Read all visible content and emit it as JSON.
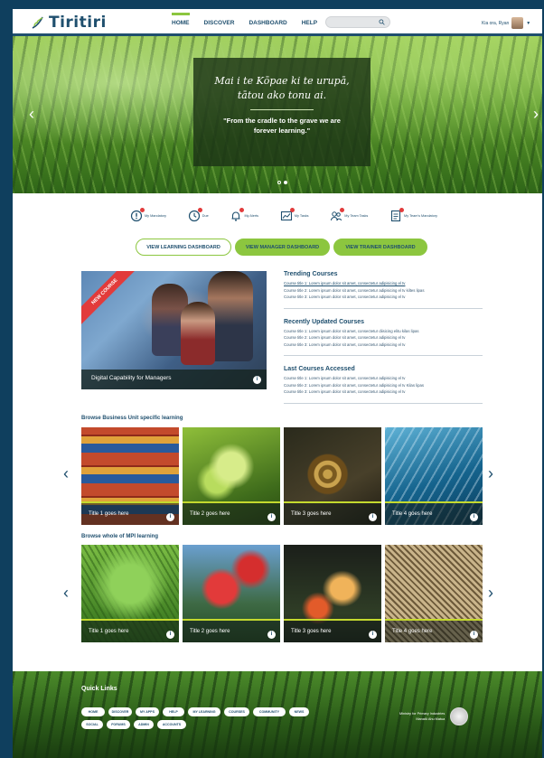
{
  "colors": {
    "navy": "#1f4f6e",
    "green": "#8cc63f",
    "badge": "#e23b3b"
  },
  "header": {
    "logo_text": "Tiritiri",
    "nav": [
      "HOME",
      "DISCOVER",
      "DASHBOARD",
      "HELP"
    ],
    "active_nav": "HOME",
    "search_placeholder": "",
    "user_greeting": "Kia ora, Ryan"
  },
  "hero": {
    "maori_line1": "Mai i te Kōpae ki te urupā,",
    "maori_line2": "tātou ako tonu ai.",
    "english": "\"From the cradle to the grave we are forever learning.\"",
    "slides": 2,
    "active_slide": 2
  },
  "stats": [
    {
      "label": "My Mandatory",
      "icon": "alert-icon"
    },
    {
      "label": "Due",
      "icon": "clock-icon"
    },
    {
      "label": "My Alerts",
      "icon": "bell-icon"
    },
    {
      "label": "My Tasks",
      "icon": "chart-icon"
    },
    {
      "label": "My Team Tasks",
      "icon": "team-icon"
    },
    {
      "label": "My Team's Mandatory",
      "icon": "document-icon"
    }
  ],
  "dashboard_buttons": {
    "learning": "VIEW LEARNING DASHBOARD",
    "manager": "VIEW MANAGER DASHBOARD",
    "trainer": "VIEW TRAINER DASHBOARD"
  },
  "feature": {
    "ribbon": "NEW COURSE",
    "title": "Digital Capability for Managers"
  },
  "lists": {
    "trending": {
      "title": "Trending Courses",
      "items": [
        "Course title 1: Lorem ipsum dolor sit amet, consectetur adipisicing el tv",
        "Course title 2: Lorem ipsum dolor sit amet, consectetur adipisicing el tv kiltes lipas",
        "Course title 3: Lorem ipsum dolor sit amet, consectetur adipisicing el tv"
      ]
    },
    "recent": {
      "title": "Recently Updated Courses",
      "items": [
        "Course title 1: Lorem ipsum dolor sit amet, consectetur diisicing elitu kilas lipas",
        "Course title 2: Lorem ipsum dolor sit amet, consectetur adipisicing el tv",
        "Course title 3: Lorem ipsum dolor sit amet, consectetur adipisicing el tv"
      ]
    },
    "last": {
      "title": "Last Courses Accessed",
      "items": [
        "Course title 1: Lorem ipsum dolor sit amet, consectetur adipisicing el tv",
        "Course title 2: Lorem ipsum dolor sit amet, consectetur adipisicing el tv Kilas lipas",
        "Course title 3: Lorem ipsum dolor sit amet, consectetur adipisicing el tv"
      ]
    }
  },
  "business_unit": {
    "title": "Browse Business Unit specific learning",
    "cards": [
      "Title 1 goes here",
      "Title 2 goes here",
      "Title 3 goes here",
      "Title 4 goes here"
    ]
  },
  "whole_mpi": {
    "title": "Browse whole of MPI learning",
    "cards": [
      "Title 1 goes here",
      "Title 2 goes here",
      "Title 3 goes here",
      "Title 4 goes here"
    ]
  },
  "footer": {
    "title": "Quick Links",
    "row1": [
      "HOME",
      "DISCOVER",
      "MY APPS",
      "HELP",
      "MY LEARNING",
      "COURSES",
      "COMMUNITY",
      "NEWS"
    ],
    "row2": [
      "SOCIAL",
      "FORUMS",
      "ADMIN",
      "ACCOUNTS"
    ],
    "ministry_line1": "Ministry for Primary Industries",
    "ministry_line2": "Manatū Ahu Matua"
  }
}
